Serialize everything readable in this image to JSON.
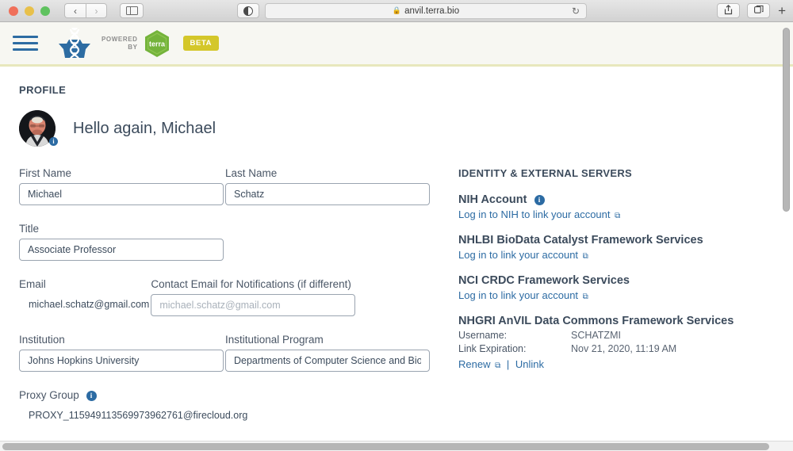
{
  "browser": {
    "url": "anvil.terra.bio",
    "lock_icon": "lock-icon",
    "back_label": "‹",
    "forward_label": "›",
    "reload_icon": "↻",
    "share_icon": "⇧",
    "tabs_icon": "⧉",
    "new_tab_label": "+"
  },
  "header": {
    "menu_icon": "hamburger-menu-icon",
    "logo_name": "anvil-logo",
    "powered_by_line1": "POWERED",
    "powered_by_line2": "BY",
    "terra_label": "terra",
    "beta_label": "BETA",
    "accent_green": "#74b33b",
    "accent_yellow": "#d4c72a",
    "divider_color": "#e8e8bd"
  },
  "profile": {
    "section_title": "PROFILE",
    "greeting": "Hello again, Michael",
    "avatar_badge": "i"
  },
  "form": {
    "first_name": {
      "label": "First Name",
      "value": "Michael"
    },
    "last_name": {
      "label": "Last Name",
      "value": "Schatz"
    },
    "title": {
      "label": "Title",
      "value": "Associate Professor"
    },
    "email": {
      "label": "Email",
      "value": "michael.schatz@gmail.com"
    },
    "contact_email": {
      "label": "Contact Email for Notifications (if different)",
      "value": "",
      "placeholder": "michael.schatz@gmail.com"
    },
    "institution": {
      "label": "Institution",
      "value": "Johns Hopkins University"
    },
    "institutional_program": {
      "label": "Institutional Program",
      "value": "Departments of Computer Science and Biology"
    },
    "proxy_group": {
      "label": "Proxy Group",
      "info": "i",
      "value": "PROXY_115949113569973962761@firecloud.org"
    }
  },
  "identity": {
    "title": "IDENTITY & EXTERNAL SERVERS",
    "link_color": "#2c6ba3",
    "services": [
      {
        "name": "NIH Account",
        "info": "i",
        "link_text": "Log in to NIH to link your account",
        "ext_icon": "⧉"
      },
      {
        "name": "NHLBI BioData Catalyst Framework Services",
        "link_text": "Log in to link your account",
        "ext_icon": "⧉"
      },
      {
        "name": "NCI CRDC Framework Services",
        "link_text": "Log in to link your account",
        "ext_icon": "⧉"
      },
      {
        "name": "NHGRI AnVIL Data Commons Framework Services",
        "username_label": "Username:",
        "username_value": "SCHATZMI",
        "expiration_label": "Link Expiration:",
        "expiration_value": "Nov 21, 2020, 11:19 AM",
        "renew_label": "Renew",
        "ext_icon": "⧉",
        "separator": "|",
        "unlink_label": "Unlink"
      }
    ]
  }
}
